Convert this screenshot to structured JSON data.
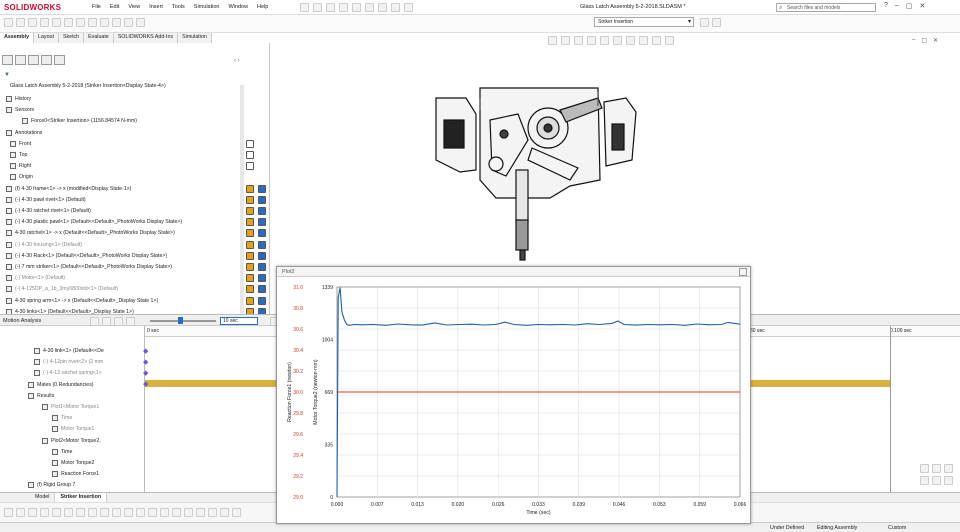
{
  "app": {
    "logo_text": "SOLIDWORKS",
    "menus": [
      "File",
      "Edit",
      "View",
      "Insert",
      "Tools",
      "Simulation",
      "Window",
      "Help"
    ],
    "document_title": "Glass Latch Assembly 5-2-2018.SLDASM *",
    "search_placeholder": "Search files and models",
    "configuration": "Striker Insertion"
  },
  "command_tabs": [
    "Assembly",
    "Layout",
    "Sketch",
    "Evaluate",
    "SOLIDWORKS Add-Ins",
    "Simulation"
  ],
  "tree": {
    "root": "Glass Latch Assembly 5-2-2018  (Striker Insertion<Display State-4>)",
    "items": [
      {
        "label": "History",
        "dim": false
      },
      {
        "label": "Sensors",
        "dim": false
      },
      {
        "label": "Force0<Striker Insertion> (1156.84574 N-mm)",
        "dim": false
      },
      {
        "label": "Annotations",
        "dim": false
      },
      {
        "label": "Front",
        "dim": false
      },
      {
        "label": "Top",
        "dim": false
      },
      {
        "label": "Right",
        "dim": false
      },
      {
        "label": "Origin",
        "dim": false
      },
      {
        "label": "(f) 4-30 frame<1> -> x (modified<Display State-1>)",
        "dim": false
      },
      {
        "label": "(-) 4-30  pawl rivet<1> (Default)",
        "dim": false
      },
      {
        "label": "(-) 4-30 ratchet rivet<1> (Default)",
        "dim": false
      },
      {
        "label": "(-) 4-30 plastic pawl<1> (Default<<Default>_PhotoWorks Display State>)",
        "dim": false
      },
      {
        "label": "4-30 ratchet<1> -> x (Default<<Default>_PhotoWorks Display State>)",
        "dim": false
      },
      {
        "label": "(-) 4-30 housing<1> (Default)",
        "dim": true
      },
      {
        "label": "(-) 4-30 Rack<1> (Default<<Default>_PhotoWorks Display State>)",
        "dim": false
      },
      {
        "label": "(-) 7 mm striker<1> (Default<<Default>_PhotoWorks Display State>)",
        "dim": false
      },
      {
        "label": "(-) Motor<1> (Default)",
        "dim": true
      },
      {
        "label": "(-) 4-125DP_a_1b_3my0800std<1> (Default)",
        "dim": true
      },
      {
        "label": "4-30 spring arm<1> -> x (Default<<Default>_Display State 1>)",
        "dim": false
      },
      {
        "label": "4-30 links<1> (Default<<Default>_Display State 1>)",
        "dim": false
      }
    ]
  },
  "motion": {
    "study_type": "Motion Analysis",
    "time_field": "10 sec",
    "time_labels": [
      "0 sec",
      "80 sec",
      "0.100 sec"
    ],
    "items": [
      {
        "label": "4-30 link<1> (Default<<De",
        "dim": false
      },
      {
        "label": "(-) 4-12pin rivet<2> (2 mm",
        "dim": true
      },
      {
        "label": "(-) 4-13 ratchet spring<1>",
        "dim": true
      },
      {
        "label": "Mates (0 Redundancies)",
        "dim": false
      },
      {
        "label": "Results",
        "dim": false
      },
      {
        "label": "Plot1<Motor Torque1",
        "dim": true
      },
      {
        "label": "Time",
        "dim": true
      },
      {
        "label": "Motor Torque1",
        "dim": true
      },
      {
        "label": "Plot2<Motor Torque2,",
        "dim": false
      },
      {
        "label": "Time",
        "dim": false
      },
      {
        "label": "Motor Torque2",
        "dim": false
      },
      {
        "label": "Reaction Force1",
        "dim": false
      },
      {
        "label": "(f) Rigid Group 7",
        "dim": false
      }
    ]
  },
  "bottom_tabs": [
    "Model",
    "Striker Insertion"
  ],
  "status": {
    "mode": "Under Defined",
    "editing": "Editing Assembly",
    "units": "Custom"
  },
  "plot": {
    "window_title": "Plot2",
    "colors": {
      "torque": "#1f5fa6",
      "force": "#d9361e",
      "grid": "#d8d8d8"
    }
  },
  "chart_data": {
    "type": "line",
    "title": "",
    "xlabel": "Time (sec)",
    "ylabel_left": "Reaction Force1 (newton)",
    "ylabel_right": "Motor Torque2 (newton-mm)",
    "x_ticks": [
      "0.000",
      "0.007",
      "0.013",
      "0.020",
      "0.026",
      "0.033",
      "0.039",
      "0.046",
      "0.053",
      "0.059",
      "0.066"
    ],
    "y_left_ticks": [
      "31.0",
      "30.8",
      "30.6",
      "30.4",
      "30.2",
      "30.0",
      "29.8",
      "29.6",
      "29.4",
      "29.2",
      "29.0"
    ],
    "y_right_ticks": [
      "1339",
      "1004",
      "669",
      "335",
      "0"
    ],
    "xlim": [
      0,
      0.066
    ],
    "ylim_right": [
      0,
      1339
    ],
    "grid": true,
    "series": [
      {
        "axis": "right",
        "x": [
          0,
          0.0002,
          0.0005,
          0.0008,
          0.0012,
          0.0016,
          0.002,
          0.0028,
          0.004,
          0.006,
          0.008,
          0.01,
          0.012,
          0.014,
          0.016,
          0.018,
          0.02,
          0.022,
          0.024,
          0.026,
          0.0275,
          0.029,
          0.031,
          0.033,
          0.035,
          0.037,
          0.039,
          0.041,
          0.043,
          0.045,
          0.046,
          0.047,
          0.049,
          0.051,
          0.053,
          0.055,
          0.057,
          0.059,
          0.061,
          0.063,
          0.064,
          0.066
        ],
        "y": [
          0,
          1270,
          1335,
          1180,
          1130,
          1100,
          1095,
          1100,
          1098,
          1100,
          1095,
          1103,
          1098,
          1096,
          1110,
          1097,
          1100,
          1102,
          1097,
          1100,
          1115,
          1100,
          1095,
          1100,
          1098,
          1100,
          1097,
          1105,
          1100,
          1107,
          1122,
          1100,
          1096,
          1100,
          1098,
          1100,
          1095,
          1103,
          1098,
          1100,
          1113,
          1102
        ]
      },
      {
        "axis": "left",
        "x": [
          0,
          0.066
        ],
        "y": [
          30.0,
          30.0
        ]
      }
    ]
  }
}
